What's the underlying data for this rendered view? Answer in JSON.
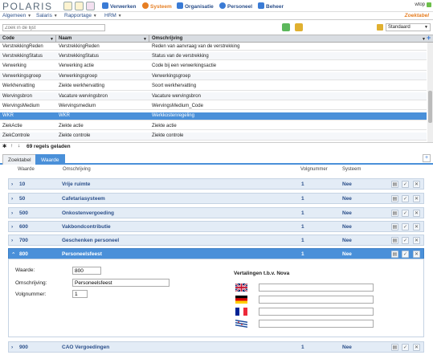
{
  "app": {
    "logo": "POLARIS",
    "user": "wtop"
  },
  "nav": [
    {
      "label": "Verwerken",
      "icon": "process-icon",
      "color": "#3a7bd5"
    },
    {
      "label": "Systeem",
      "icon": "gear-icon",
      "color": "#e67e22"
    },
    {
      "label": "Organisatie",
      "icon": "org-icon",
      "color": "#3a7bd5"
    },
    {
      "label": "Personeel",
      "icon": "people-icon",
      "color": "#3a7bd5"
    },
    {
      "label": "Beheer",
      "icon": "admin-icon",
      "color": "#3a7bd5"
    }
  ],
  "menu": [
    "Algemeen",
    "Salaris",
    "Rapportage",
    "HRM"
  ],
  "page_title": "Zoektabel",
  "search": {
    "placeholder": "Zoek in de lijst",
    "value": ""
  },
  "view_select": {
    "value": "Standaard"
  },
  "grid": {
    "columns": [
      "Code",
      "Naam",
      "Omschrijving"
    ],
    "rows": [
      [
        "VerstrekkingReden",
        "VerstrekkingReden",
        "Reden van aanvraag van de verstrekking"
      ],
      [
        "VerstrekkingStatus",
        "VerstrekkingStatus",
        "Status van de verstrekking"
      ],
      [
        "Verwerking",
        "Verwerking actie",
        "Code bij een verwerkingsactie"
      ],
      [
        "Verwerkingsgroep",
        "Verwerkingsgroep",
        "Verwerkingsgroep"
      ],
      [
        "Werkhervatting",
        "Ziekte werkhervatting",
        "Soort werkhervatting"
      ],
      [
        "Wervingsbron",
        "Vacature wervingsbron",
        "Vacature wervingsbron"
      ],
      [
        "WervingsMedium",
        "Wervingsmedium",
        "WervingsMedium_Code"
      ],
      [
        "WKR",
        "WKR",
        "Werkkostenregeling"
      ],
      [
        "ZiekActie",
        "Ziekte actie",
        "Ziekte actie"
      ],
      [
        "ZiekControle",
        "Ziekte controle",
        "Ziekte controle"
      ]
    ],
    "selected_index": 7,
    "status": "69 regels geladen"
  },
  "tabs": [
    "Zoektabel",
    "Waarde"
  ],
  "active_tab": "Waarde",
  "waarde_headers": [
    "Waarde",
    "Omschrijving",
    "Volgnummer",
    "Systeem"
  ],
  "waarde_rows": [
    {
      "waarde": "10",
      "omschrijving": "Vrije ruimte",
      "volgnummer": "1",
      "systeem": "Nee"
    },
    {
      "waarde": "50",
      "omschrijving": "Cafetariasysteem",
      "volgnummer": "1",
      "systeem": "Nee"
    },
    {
      "waarde": "500",
      "omschrijving": "Onkostenvergoeding",
      "volgnummer": "1",
      "systeem": "Nee"
    },
    {
      "waarde": "600",
      "omschrijving": "Vakbondcontributie",
      "volgnummer": "1",
      "systeem": "Nee"
    },
    {
      "waarde": "700",
      "omschrijving": "Geschenken personeel",
      "volgnummer": "1",
      "systeem": "Nee"
    },
    {
      "waarde": "800",
      "omschrijving": "Personeelsfeest",
      "volgnummer": "1",
      "systeem": "Nee"
    },
    {
      "waarde": "900",
      "omschrijving": "CAO Vergoedingen",
      "volgnummer": "1",
      "systeem": "Nee"
    }
  ],
  "detail": {
    "waarde_label": "Waarde:",
    "waarde_value": "800",
    "omschrijving_label": "Omschrijving:",
    "omschrijving_value": "Personeelsfeest",
    "volgnummer_label": "Volgnummer:",
    "volgnummer_value": "1",
    "translations_title": "Vertalingen t.b.v. Nova",
    "translations": [
      {
        "flag": "uk-flag-icon",
        "value": ""
      },
      {
        "flag": "de-flag-icon",
        "value": ""
      },
      {
        "flag": "fr-flag-icon",
        "value": ""
      },
      {
        "flag": "fy-flag-icon",
        "value": ""
      }
    ]
  },
  "colors": {
    "accent": "#4a90d9",
    "title": "#e67e22",
    "nav_text": "#2b4f8a"
  }
}
